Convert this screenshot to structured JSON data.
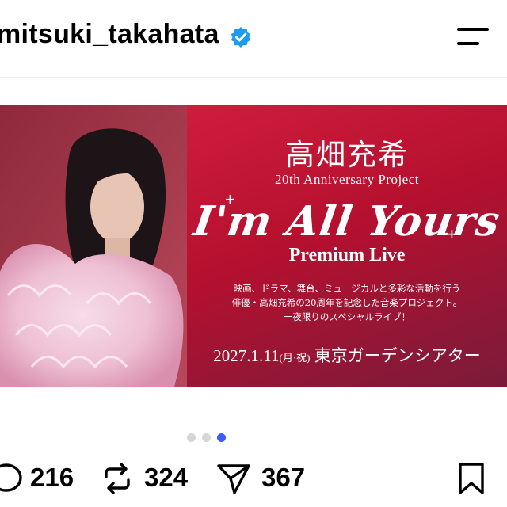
{
  "header": {
    "username": "mitsuki_takahata",
    "verified_icon": "verified-badge-icon",
    "menu_icon": "hamburger-menu-icon",
    "accent": "#1d9bf0"
  },
  "post": {
    "banner": {
      "name": "高畑充希",
      "project": "20th Anniversary Project",
      "script_title": "I'm All Yours",
      "premium": "Premium Live",
      "desc_line1": "映画、ドラマ、舞台、ミュージカルと多彩な活動を行う",
      "desc_line2": "俳優・高畑充希の20周年を記念した音楽プロジェクト。",
      "desc_line3": "一夜限りのスペシャルライブ！",
      "date": "2027.1.11",
      "date_day": "(月·祝)",
      "venue": "東京ガーデンシアター",
      "bg_color": "#c4163a"
    }
  },
  "carousel": {
    "count": 3,
    "active_index": 2,
    "active_color": "#3b5bfd",
    "inactive_color": "#d6d6d6"
  },
  "actions": {
    "comment_count": "216",
    "repost_count": "324",
    "share_count": "367",
    "icons": [
      "comment-icon",
      "repost-icon",
      "share-icon",
      "bookmark-icon"
    ]
  }
}
